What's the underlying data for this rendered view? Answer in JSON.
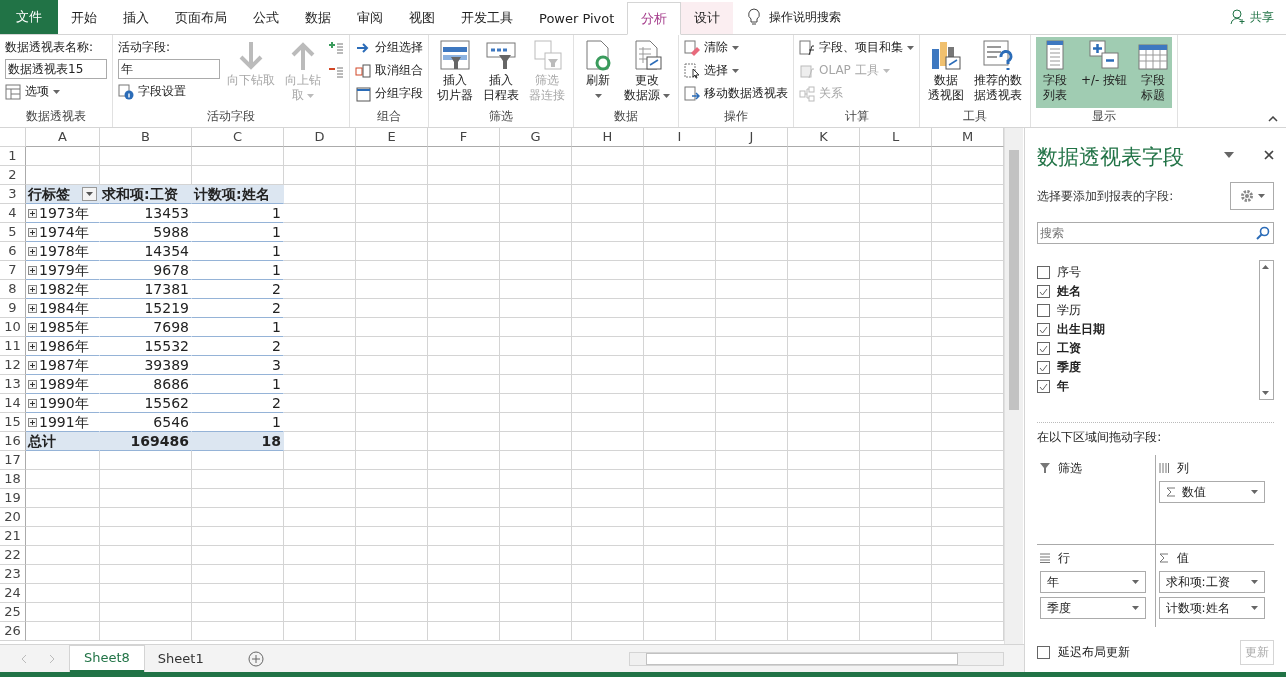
{
  "tabs": [
    {
      "label": "文件",
      "kind": "file",
      "selected": false
    },
    {
      "label": "开始",
      "kind": "normal",
      "selected": false
    },
    {
      "label": "插入",
      "kind": "normal",
      "selected": false
    },
    {
      "label": "页面布局",
      "kind": "normal",
      "selected": false
    },
    {
      "label": "公式",
      "kind": "normal",
      "selected": false
    },
    {
      "label": "数据",
      "kind": "normal",
      "selected": false
    },
    {
      "label": "审阅",
      "kind": "normal",
      "selected": false
    },
    {
      "label": "视图",
      "kind": "normal",
      "selected": false
    },
    {
      "label": "开发工具",
      "kind": "normal",
      "selected": false
    },
    {
      "label": "Power Pivot",
      "kind": "normal",
      "selected": false
    },
    {
      "label": "分析",
      "kind": "context",
      "selected": true
    },
    {
      "label": "设计",
      "kind": "context",
      "selected": false
    }
  ],
  "tell_me": "操作说明搜索",
  "share": "共享",
  "ribbon": [
    {
      "label": "数据透视表",
      "columns": [
        [
          {
            "kind": "caption",
            "label": "数据透视表名称:"
          },
          {
            "kind": "field",
            "value": "数据透视表15"
          },
          {
            "kind": "small",
            "label": "选项",
            "dropdown": true,
            "disabled": false
          }
        ]
      ]
    },
    {
      "label": "活动字段",
      "columns": [
        [
          {
            "kind": "caption",
            "label": "活动字段:"
          },
          {
            "kind": "field",
            "value": "年"
          },
          {
            "kind": "small",
            "label": "字段设置",
            "disabled": false
          }
        ],
        [
          {
            "kind": "large",
            "lines": [
              "向下钻取"
            ],
            "disabled": true
          }
        ],
        [
          {
            "kind": "large",
            "lines": [
              "向上钻",
              "取"
            ],
            "dropdown": true,
            "disabled": true
          }
        ],
        [
          {
            "kind": "icon",
            "disabled": false
          },
          {
            "kind": "icon",
            "disabled": false
          }
        ]
      ]
    },
    {
      "label": "组合",
      "columns": [
        [
          {
            "kind": "small",
            "label": "分组选择",
            "disabled": false
          },
          {
            "kind": "small",
            "label": "取消组合",
            "disabled": false
          },
          {
            "kind": "small",
            "label": "分组字段",
            "disabled": false
          }
        ]
      ]
    },
    {
      "label": "筛选",
      "columns": [
        [
          {
            "kind": "large",
            "lines": [
              "插入",
              "切片器"
            ],
            "disabled": false
          }
        ],
        [
          {
            "kind": "large",
            "lines": [
              "插入",
              "日程表"
            ],
            "disabled": false
          }
        ],
        [
          {
            "kind": "large",
            "lines": [
              "筛选",
              "器连接"
            ],
            "disabled": true
          }
        ]
      ]
    },
    {
      "label": "数据",
      "columns": [
        [
          {
            "kind": "large",
            "lines": [
              "刷新"
            ],
            "dropdown": true,
            "disabled": false
          }
        ],
        [
          {
            "kind": "large",
            "lines": [
              "更改",
              "数据源"
            ],
            "dropdown": true,
            "disabled": false
          }
        ]
      ]
    },
    {
      "label": "操作",
      "columns": [
        [
          {
            "kind": "small",
            "label": "清除",
            "dropdown": true,
            "disabled": false
          },
          {
            "kind": "small",
            "label": "选择",
            "dropdown": true,
            "disabled": false
          },
          {
            "kind": "small",
            "label": "移动数据透视表",
            "disabled": false
          }
        ]
      ]
    },
    {
      "label": "计算",
      "columns": [
        [
          {
            "kind": "small",
            "label": "字段、项目和集",
            "dropdown": true,
            "disabled": false
          },
          {
            "kind": "small",
            "label": "OLAP 工具",
            "dropdown": true,
            "disabled": true
          },
          {
            "kind": "small",
            "label": "关系",
            "disabled": true
          }
        ]
      ]
    },
    {
      "label": "工具",
      "columns": [
        [
          {
            "kind": "large",
            "lines": [
              "数据",
              "透视图"
            ],
            "disabled": false
          }
        ],
        [
          {
            "kind": "large",
            "lines": [
              "推荐的数",
              "据透视表"
            ],
            "disabled": false
          }
        ]
      ]
    },
    {
      "label": "显示",
      "columns": [
        [
          {
            "kind": "large",
            "lines": [
              "字段",
              "列表"
            ],
            "disabled": false,
            "selected": true
          }
        ],
        [
          {
            "kind": "large",
            "lines": [
              "+/- 按钮"
            ],
            "disabled": false,
            "selected": true
          }
        ],
        [
          {
            "kind": "large",
            "lines": [
              "字段",
              "标题"
            ],
            "disabled": false,
            "selected": true
          }
        ]
      ]
    }
  ],
  "sheet": {
    "columns": [
      "A",
      "B",
      "C",
      "D",
      "E",
      "F",
      "G",
      "H",
      "I",
      "J",
      "K",
      "L",
      "M"
    ],
    "rows": [
      {
        "number": "1"
      },
      {
        "number": "2"
      },
      {
        "number": "3",
        "kind": "header",
        "cells": [
          "行标签",
          "求和项:工资",
          "计数项:姓名"
        ]
      },
      {
        "number": "4",
        "kind": "item",
        "cells": [
          "1973年",
          "13453",
          "1"
        ]
      },
      {
        "number": "5",
        "kind": "item",
        "cells": [
          "1974年",
          "5988",
          "1"
        ]
      },
      {
        "number": "6",
        "kind": "item",
        "cells": [
          "1978年",
          "14354",
          "1"
        ]
      },
      {
        "number": "7",
        "kind": "item",
        "cells": [
          "1979年",
          "9678",
          "1"
        ]
      },
      {
        "number": "8",
        "kind": "item",
        "cells": [
          "1982年",
          "17381",
          "2"
        ]
      },
      {
        "number": "9",
        "kind": "item",
        "cells": [
          "1984年",
          "15219",
          "2"
        ]
      },
      {
        "number": "10",
        "kind": "item",
        "cells": [
          "1985年",
          "7698",
          "1"
        ]
      },
      {
        "number": "11",
        "kind": "item",
        "cells": [
          "1986年",
          "15532",
          "2"
        ]
      },
      {
        "number": "12",
        "kind": "item",
        "cells": [
          "1987年",
          "39389",
          "3"
        ]
      },
      {
        "number": "13",
        "kind": "item",
        "cells": [
          "1989年",
          "8686",
          "1"
        ]
      },
      {
        "number": "14",
        "kind": "item",
        "cells": [
          "1990年",
          "15562",
          "2"
        ]
      },
      {
        "number": "15",
        "kind": "item",
        "cells": [
          "1991年",
          "6546",
          "1"
        ]
      },
      {
        "number": "16",
        "kind": "total",
        "cells": [
          "总计",
          "169486",
          "18"
        ]
      },
      {
        "number": "17"
      },
      {
        "number": "18"
      },
      {
        "number": "19"
      },
      {
        "number": "20"
      },
      {
        "number": "21"
      },
      {
        "number": "22"
      },
      {
        "number": "23"
      },
      {
        "number": "24"
      },
      {
        "number": "25"
      },
      {
        "number": "26"
      }
    ]
  },
  "sheet_tabs": [
    {
      "label": "Sheet8",
      "selected": true
    },
    {
      "label": "Sheet1",
      "selected": false
    }
  ],
  "field_pane": {
    "title": "数据透视表字段",
    "subtitle": "选择要添加到报表的字段:",
    "search": {
      "placeholder": "搜索"
    },
    "fields": [
      {
        "label": "序号",
        "checked": false
      },
      {
        "label": "姓名",
        "checked": true
      },
      {
        "label": "学历",
        "checked": false
      },
      {
        "label": "出生日期",
        "checked": true
      },
      {
        "label": "工资",
        "checked": true
      },
      {
        "label": "季度",
        "checked": true
      },
      {
        "label": "年",
        "checked": true
      }
    ],
    "areas_caption": "在以下区域间拖动字段:",
    "areas": [
      {
        "kind": "filter",
        "label": "筛选"
      },
      {
        "kind": "columns",
        "label": "列",
        "items": [
          {
            "label": "数值",
            "sigma": true
          }
        ]
      },
      {
        "kind": "rows",
        "label": "行",
        "items": [
          {
            "label": "年"
          },
          {
            "label": "季度"
          }
        ]
      },
      {
        "kind": "values",
        "label": "值",
        "items": [
          {
            "label": "求和项:工资"
          },
          {
            "label": "计数项:姓名"
          }
        ]
      }
    ],
    "defer": {
      "label": "延迟布局更新",
      "checked": false
    },
    "update": {
      "label": "更新",
      "disabled": true
    }
  }
}
